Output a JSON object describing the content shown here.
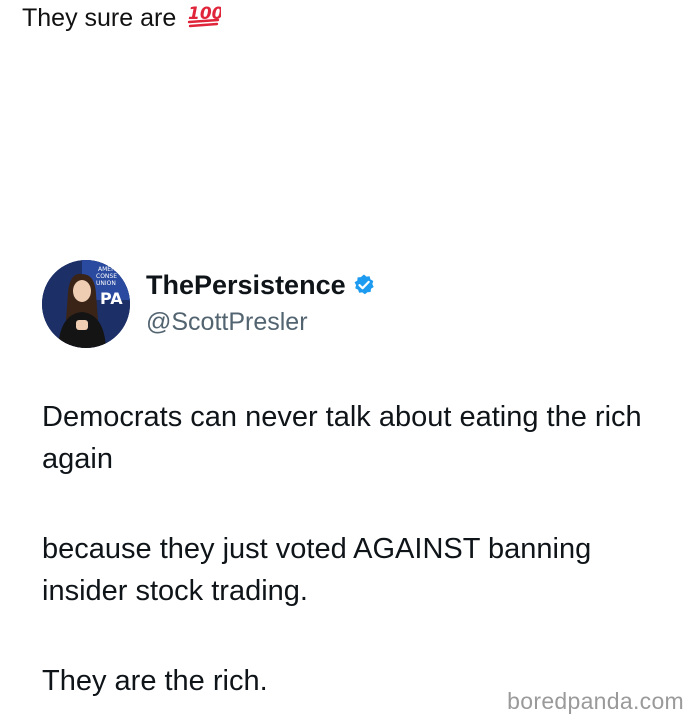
{
  "caption": {
    "text": "They sure are",
    "emoji": "hundred-points-emoji"
  },
  "post": {
    "display_name": "ThePersistence",
    "handle": "@ScottPresler",
    "verified": true,
    "avatar_banner_text": "TPA",
    "paragraphs": [
      "Democrats can never talk about eating the rich again",
      "because they just voted AGAINST banning insider stock trading.",
      "They are the rich."
    ]
  },
  "watermark": "boredpanda.com",
  "colors": {
    "text": "#0f1419",
    "secondary": "#536471",
    "verified": "#1d9bf0",
    "emoji_red": "#e0243a"
  }
}
